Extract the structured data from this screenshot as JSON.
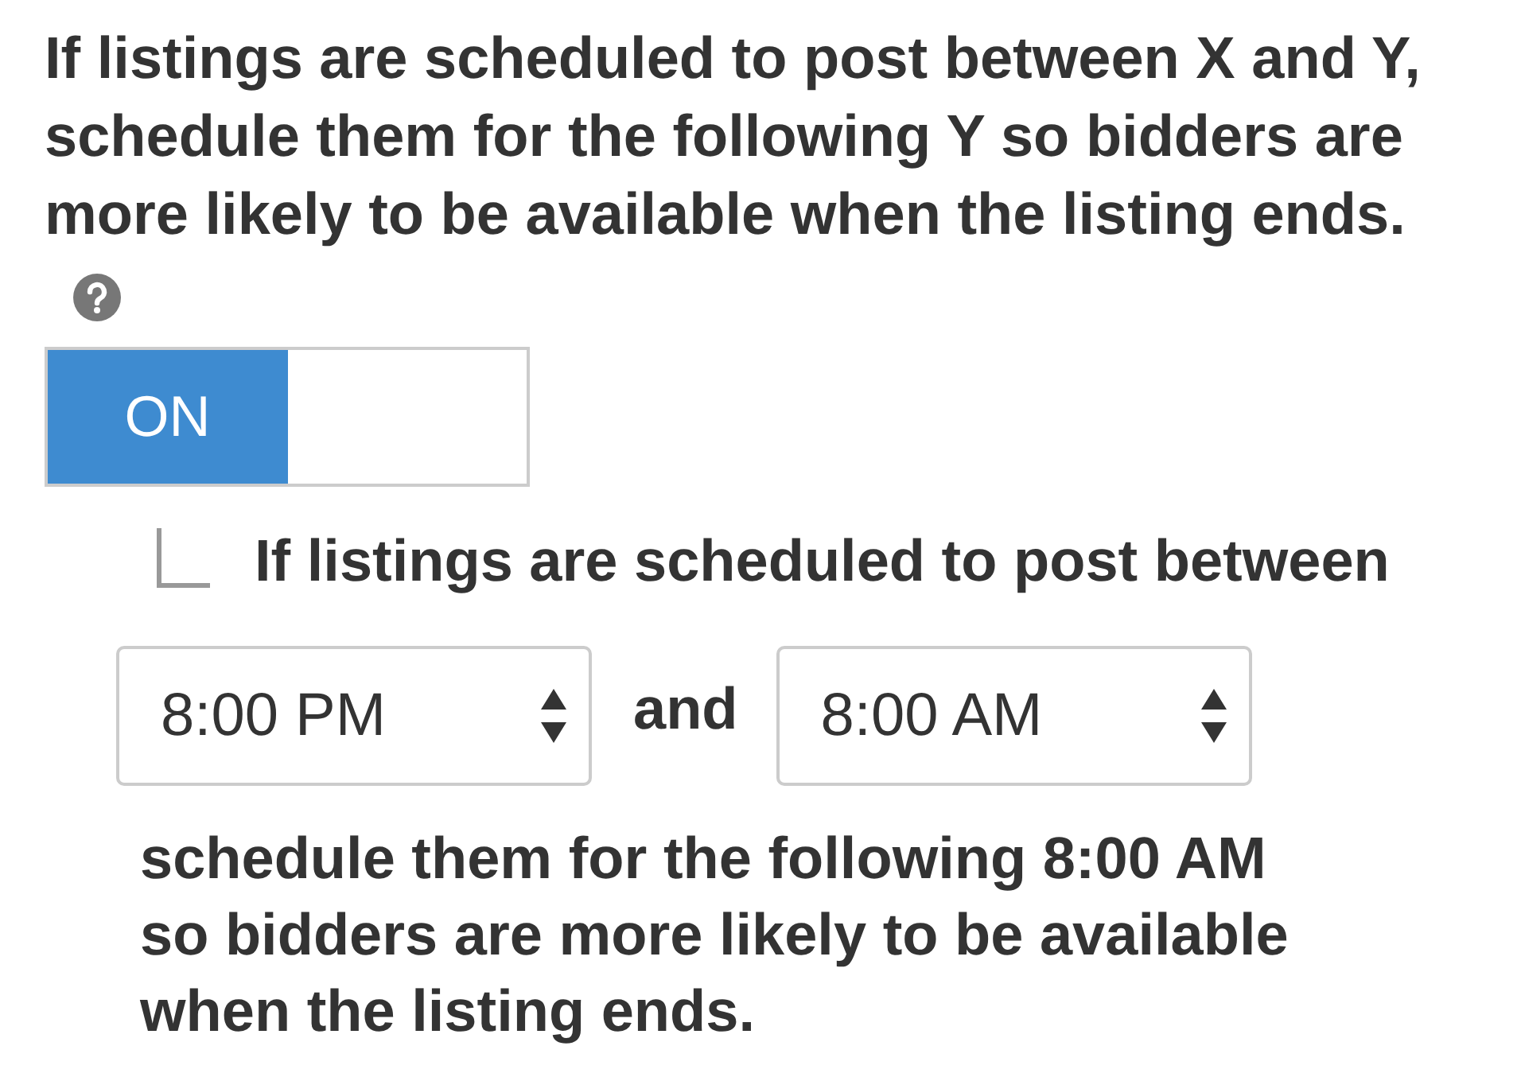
{
  "description": {
    "text": "If listings are scheduled to post between X and Y, schedule them for the following Y so bidders are more likely to be available when the listing ends."
  },
  "toggle": {
    "label": "ON",
    "on": true
  },
  "condition": {
    "label": "If listings are scheduled to post between"
  },
  "start_time": {
    "value": "8:00 PM"
  },
  "joiner": "and",
  "end_time": {
    "value": "8:00 AM"
  },
  "result": "schedule them for the following 8:00 AM so bidders are more likely to be available when the listing ends."
}
